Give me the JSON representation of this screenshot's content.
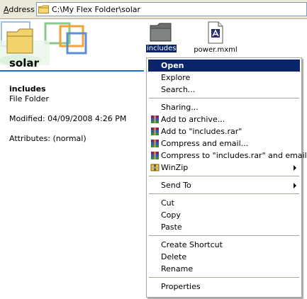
{
  "address": {
    "label_prefix": "A",
    "label_rest": "ddress",
    "path": "C:\\My Flex Folder\\solar"
  },
  "left_pane": {
    "folder_title": "solar",
    "details": {
      "name": "includes",
      "type": "File Folder",
      "modified": "Modified: 04/09/2008 4:26 PM",
      "attributes": "Attributes: (normal)"
    }
  },
  "files": [
    {
      "name": "includes",
      "icon": "folder-icon",
      "selected": true
    },
    {
      "name": "power.mxml",
      "icon": "mxml-file-icon",
      "selected": false
    }
  ],
  "context_menu": {
    "groups": [
      [
        {
          "label": "Open",
          "default": true,
          "highlighted": true
        },
        {
          "label": "Explore"
        },
        {
          "label": "Search..."
        }
      ],
      [
        {
          "label": "Sharing..."
        },
        {
          "label": "Add to archive...",
          "icon": "winrar-icon"
        },
        {
          "label": "Add to \"includes.rar\"",
          "icon": "winrar-icon"
        },
        {
          "label": "Compress and email...",
          "icon": "winrar-icon"
        },
        {
          "label": "Compress to \"includes.rar\" and email",
          "icon": "winrar-icon"
        },
        {
          "label": "WinZip",
          "icon": "winzip-icon",
          "submenu": true
        }
      ],
      [
        {
          "label": "Send To",
          "submenu": true
        }
      ],
      [
        {
          "label": "Cut"
        },
        {
          "label": "Copy"
        },
        {
          "label": "Paste"
        }
      ],
      [
        {
          "label": "Create Shortcut"
        },
        {
          "label": "Delete"
        },
        {
          "label": "Rename"
        }
      ],
      [
        {
          "label": "Properties"
        }
      ]
    ]
  },
  "colors": {
    "highlight": "#0a246a",
    "rule_blue": "#1e6bd8",
    "chrome": "#ece9d8"
  }
}
